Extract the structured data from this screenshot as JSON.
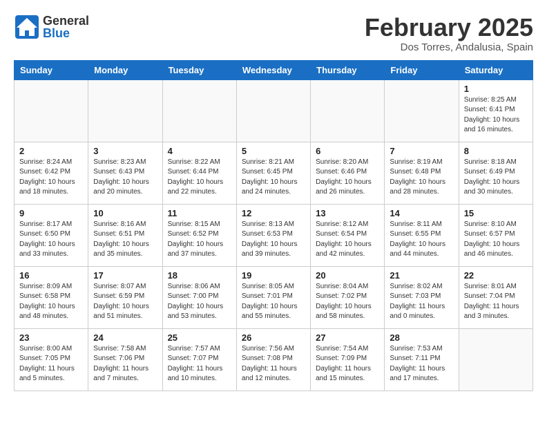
{
  "header": {
    "logo_general": "General",
    "logo_blue": "Blue",
    "month_title": "February 2025",
    "location": "Dos Torres, Andalusia, Spain"
  },
  "days_of_week": [
    "Sunday",
    "Monday",
    "Tuesday",
    "Wednesday",
    "Thursday",
    "Friday",
    "Saturday"
  ],
  "weeks": [
    {
      "days": [
        {
          "num": "",
          "info": ""
        },
        {
          "num": "",
          "info": ""
        },
        {
          "num": "",
          "info": ""
        },
        {
          "num": "",
          "info": ""
        },
        {
          "num": "",
          "info": ""
        },
        {
          "num": "",
          "info": ""
        },
        {
          "num": "1",
          "info": "Sunrise: 8:25 AM\nSunset: 6:41 PM\nDaylight: 10 hours\nand 16 minutes."
        }
      ]
    },
    {
      "days": [
        {
          "num": "2",
          "info": "Sunrise: 8:24 AM\nSunset: 6:42 PM\nDaylight: 10 hours\nand 18 minutes."
        },
        {
          "num": "3",
          "info": "Sunrise: 8:23 AM\nSunset: 6:43 PM\nDaylight: 10 hours\nand 20 minutes."
        },
        {
          "num": "4",
          "info": "Sunrise: 8:22 AM\nSunset: 6:44 PM\nDaylight: 10 hours\nand 22 minutes."
        },
        {
          "num": "5",
          "info": "Sunrise: 8:21 AM\nSunset: 6:45 PM\nDaylight: 10 hours\nand 24 minutes."
        },
        {
          "num": "6",
          "info": "Sunrise: 8:20 AM\nSunset: 6:46 PM\nDaylight: 10 hours\nand 26 minutes."
        },
        {
          "num": "7",
          "info": "Sunrise: 8:19 AM\nSunset: 6:48 PM\nDaylight: 10 hours\nand 28 minutes."
        },
        {
          "num": "8",
          "info": "Sunrise: 8:18 AM\nSunset: 6:49 PM\nDaylight: 10 hours\nand 30 minutes."
        }
      ]
    },
    {
      "days": [
        {
          "num": "9",
          "info": "Sunrise: 8:17 AM\nSunset: 6:50 PM\nDaylight: 10 hours\nand 33 minutes."
        },
        {
          "num": "10",
          "info": "Sunrise: 8:16 AM\nSunset: 6:51 PM\nDaylight: 10 hours\nand 35 minutes."
        },
        {
          "num": "11",
          "info": "Sunrise: 8:15 AM\nSunset: 6:52 PM\nDaylight: 10 hours\nand 37 minutes."
        },
        {
          "num": "12",
          "info": "Sunrise: 8:13 AM\nSunset: 6:53 PM\nDaylight: 10 hours\nand 39 minutes."
        },
        {
          "num": "13",
          "info": "Sunrise: 8:12 AM\nSunset: 6:54 PM\nDaylight: 10 hours\nand 42 minutes."
        },
        {
          "num": "14",
          "info": "Sunrise: 8:11 AM\nSunset: 6:55 PM\nDaylight: 10 hours\nand 44 minutes."
        },
        {
          "num": "15",
          "info": "Sunrise: 8:10 AM\nSunset: 6:57 PM\nDaylight: 10 hours\nand 46 minutes."
        }
      ]
    },
    {
      "days": [
        {
          "num": "16",
          "info": "Sunrise: 8:09 AM\nSunset: 6:58 PM\nDaylight: 10 hours\nand 48 minutes."
        },
        {
          "num": "17",
          "info": "Sunrise: 8:07 AM\nSunset: 6:59 PM\nDaylight: 10 hours\nand 51 minutes."
        },
        {
          "num": "18",
          "info": "Sunrise: 8:06 AM\nSunset: 7:00 PM\nDaylight: 10 hours\nand 53 minutes."
        },
        {
          "num": "19",
          "info": "Sunrise: 8:05 AM\nSunset: 7:01 PM\nDaylight: 10 hours\nand 55 minutes."
        },
        {
          "num": "20",
          "info": "Sunrise: 8:04 AM\nSunset: 7:02 PM\nDaylight: 10 hours\nand 58 minutes."
        },
        {
          "num": "21",
          "info": "Sunrise: 8:02 AM\nSunset: 7:03 PM\nDaylight: 11 hours\nand 0 minutes."
        },
        {
          "num": "22",
          "info": "Sunrise: 8:01 AM\nSunset: 7:04 PM\nDaylight: 11 hours\nand 3 minutes."
        }
      ]
    },
    {
      "days": [
        {
          "num": "23",
          "info": "Sunrise: 8:00 AM\nSunset: 7:05 PM\nDaylight: 11 hours\nand 5 minutes."
        },
        {
          "num": "24",
          "info": "Sunrise: 7:58 AM\nSunset: 7:06 PM\nDaylight: 11 hours\nand 7 minutes."
        },
        {
          "num": "25",
          "info": "Sunrise: 7:57 AM\nSunset: 7:07 PM\nDaylight: 11 hours\nand 10 minutes."
        },
        {
          "num": "26",
          "info": "Sunrise: 7:56 AM\nSunset: 7:08 PM\nDaylight: 11 hours\nand 12 minutes."
        },
        {
          "num": "27",
          "info": "Sunrise: 7:54 AM\nSunset: 7:09 PM\nDaylight: 11 hours\nand 15 minutes."
        },
        {
          "num": "28",
          "info": "Sunrise: 7:53 AM\nSunset: 7:11 PM\nDaylight: 11 hours\nand 17 minutes."
        },
        {
          "num": "",
          "info": ""
        }
      ]
    }
  ]
}
